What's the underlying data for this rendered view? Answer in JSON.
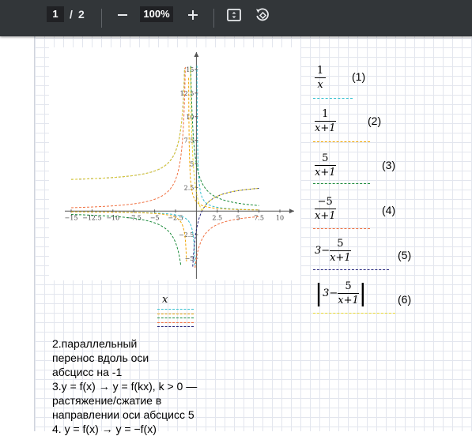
{
  "toolbar": {
    "page_current": "1",
    "page_sep": "/",
    "page_total": "2",
    "zoom": "100%",
    "icons": [
      "minus-icon",
      "plus-icon",
      "fit-page-icon",
      "rotate-icon"
    ]
  },
  "chart_data": {
    "type": "line",
    "x_ticks": [
      "−15",
      "−12.5",
      "−10",
      "−7.5",
      "−5",
      "−2.5",
      "0",
      "2.5",
      "5",
      "7.5",
      "10"
    ],
    "y_ticks": [
      "−5",
      "−2.5",
      "2.5",
      "5",
      "7.5",
      "10",
      "12.5",
      "15"
    ],
    "xlim": [
      -15,
      10
    ],
    "ylim": [
      -5,
      15
    ],
    "functions": [
      "1/x",
      "1/(x+1)",
      "5/(x+1)",
      "-5/(x+1)",
      "3-5/(x+1)",
      "|3-5/(x+1)|"
    ],
    "grid": false
  },
  "equations": [
    {
      "num": "1",
      "den": "x",
      "prefix": "",
      "label": "(1)",
      "color": "#34c0cf"
    },
    {
      "num": "1",
      "den": "x+1",
      "prefix": "",
      "label": "(2)",
      "color": "#f0a500"
    },
    {
      "num": "5",
      "den": "x+1",
      "prefix": "",
      "label": "(3)",
      "color": "#1a8a3a"
    },
    {
      "num": "−5",
      "den": "x+1",
      "prefix": "",
      "label": "(4)",
      "color": "#f07040"
    },
    {
      "num": "5",
      "den": "x+1",
      "prefix": "3−",
      "label": "(5)",
      "color": "#23237a"
    },
    {
      "num": "5",
      "den": "x+1",
      "prefix": "3−",
      "label": "(6)",
      "color": "#e8d830"
    }
  ],
  "legend": {
    "label": "x",
    "colors": [
      "#34c0cf",
      "#f0a500",
      "#1a8a3a",
      "#f07040",
      "#23237a"
    ]
  },
  "notes": [
    "2.параллельный",
    "перенос вдоль оси",
    "абсцисс на -1",
    "3.y = f(x) → y = f(kx), k > 0 —",
    "растяжение/сжатие в",
    "направлении оси абсцисс 5",
    "4. y = f(x) → y = −f(x)"
  ]
}
